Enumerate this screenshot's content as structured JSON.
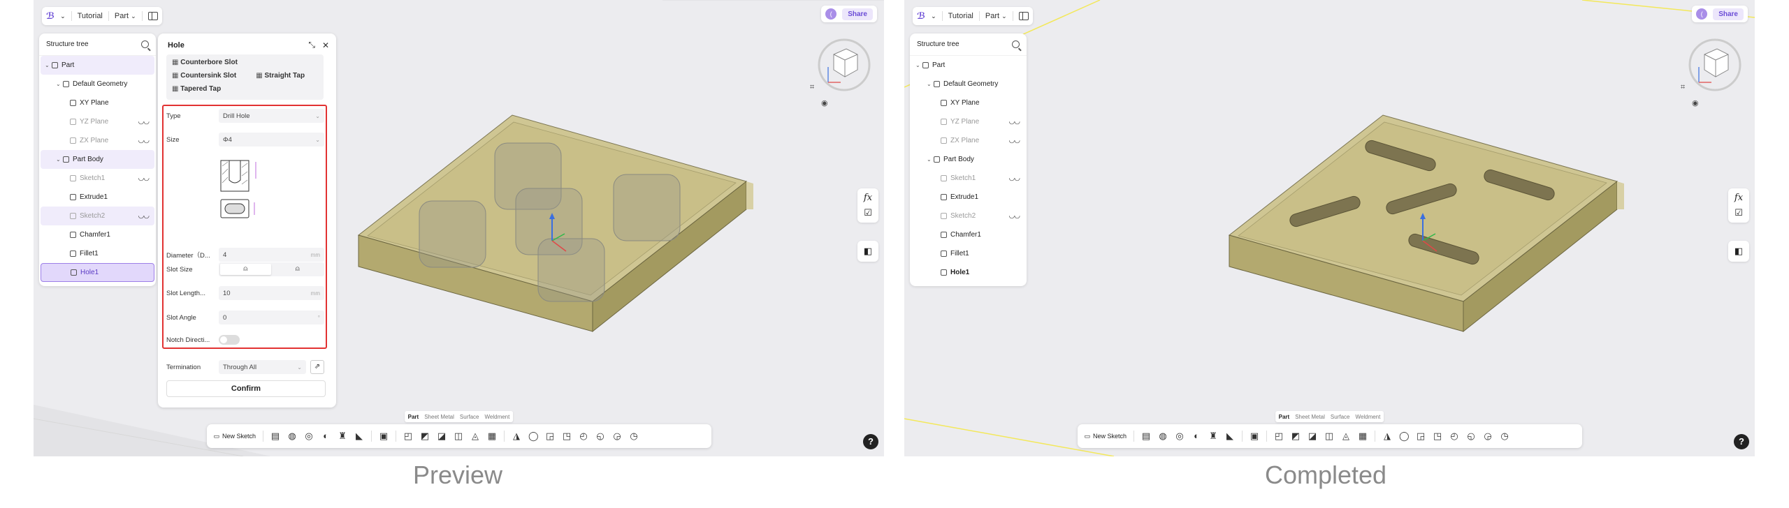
{
  "captions": {
    "left": "Preview",
    "right": "Completed"
  },
  "topbar": {
    "logo": "ℬ",
    "doc": "Tutorial",
    "mode": "Part",
    "mode_arrow": "⌄",
    "logo_arrow": "⌄"
  },
  "share": {
    "user": "(",
    "button": "Share"
  },
  "tree": {
    "title": "Structure tree",
    "items": [
      {
        "label": "Part",
        "chev": "⌄"
      },
      {
        "label": "Default Geometry",
        "chev": "⌄"
      },
      {
        "label": "XY Plane"
      },
      {
        "label": "YZ Plane"
      },
      {
        "label": "ZX Plane"
      },
      {
        "label": "Part Body",
        "chev": "⌄"
      },
      {
        "label": "Sketch1"
      },
      {
        "label": "Extrude1"
      },
      {
        "label": "Sketch2"
      },
      {
        "label": "Chamfer1"
      },
      {
        "label": "Fillet1"
      },
      {
        "label": "Hole1"
      }
    ],
    "eye_glyph": "◡◡"
  },
  "hole": {
    "title": "Hole",
    "pin_glyph": "⤡",
    "close_glyph": "✕",
    "types_row1": [
      "Counterbore Slot"
    ],
    "types_row2": [
      "Countersink Slot",
      "Straight Tap"
    ],
    "types_row3": [
      "Tapered Tap"
    ],
    "fields": {
      "type_label": "Type",
      "type_value": "Drill Hole",
      "size_label": "Size",
      "size_value": "Φ4",
      "diameter_label": "Diameter（D...",
      "diameter_value": "4",
      "diameter_unit": "mm",
      "slot_size_label": "Slot Size",
      "slot_length_label": "Slot Length...",
      "slot_length_value": "10",
      "slot_length_unit": "mm",
      "slot_angle_label": "Slot Angle",
      "slot_angle_value": "0",
      "slot_angle_unit": "°",
      "notch_label": "Notch Directi...",
      "termination_label": "Termination",
      "termination_value": "Through All"
    },
    "confirm": "Confirm"
  },
  "side_tools": {
    "fx": "fx",
    "check": "☑",
    "table": "◧"
  },
  "help": "?",
  "mode_tabs": [
    "Part",
    "Sheet Metal",
    "Surface",
    "Weldment"
  ],
  "bottombar": {
    "new_sketch": "New Sketch",
    "tools": [
      "▤",
      "◍",
      "◎",
      "◐",
      "♜",
      "◣",
      "▣",
      "◰",
      "◩",
      "◪",
      "◫",
      "◬",
      "▦",
      "◮",
      "◯",
      "◲",
      "◳",
      "◴",
      "◵",
      "◶",
      "◷"
    ]
  },
  "colors": {
    "accent": "#6a4bd6",
    "highlight_box": "#e23232",
    "plate": "#cfc693"
  }
}
